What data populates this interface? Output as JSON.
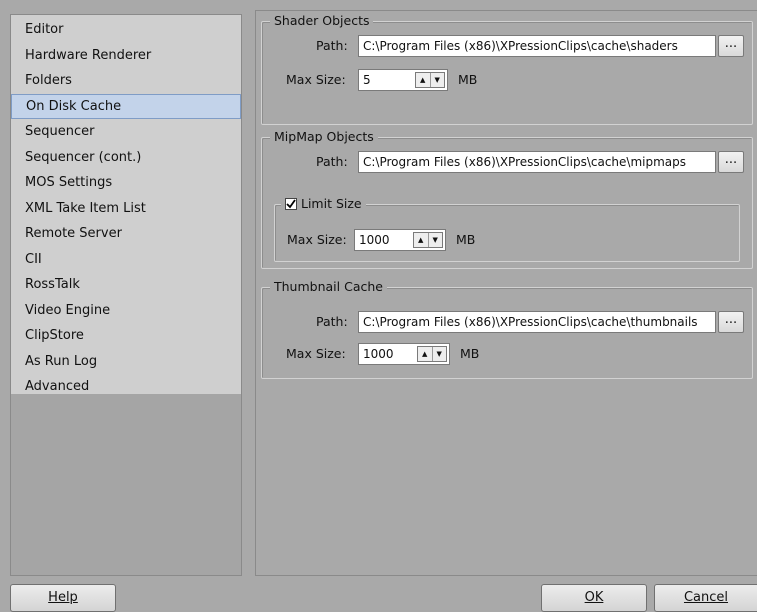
{
  "sidebar": {
    "items": [
      {
        "label": "Editor"
      },
      {
        "label": "Hardware Renderer"
      },
      {
        "label": "Folders"
      },
      {
        "label": "On Disk Cache",
        "selected": true
      },
      {
        "label": "Sequencer"
      },
      {
        "label": "Sequencer (cont.)"
      },
      {
        "label": "MOS Settings"
      },
      {
        "label": "XML Take Item List"
      },
      {
        "label": "Remote Server"
      },
      {
        "label": "CII"
      },
      {
        "label": "RossTalk"
      },
      {
        "label": "Video Engine"
      },
      {
        "label": "ClipStore"
      },
      {
        "label": "As Run Log"
      },
      {
        "label": "Advanced"
      }
    ]
  },
  "shader": {
    "title": "Shader Objects",
    "path_label": "Path:",
    "path_value": "C:\\Program Files (x86)\\XPressionClips\\cache\\shaders",
    "browse_label": "...",
    "maxsize_label": "Max Size:",
    "maxsize_value": "5",
    "unit": "MB"
  },
  "mipmap": {
    "title": "MipMap Objects",
    "path_label": "Path:",
    "path_value": "C:\\Program Files (x86)\\XPressionClips\\cache\\mipmaps",
    "browse_label": "...",
    "limit_label": "Limit Size",
    "limit_checked": true,
    "maxsize_label": "Max Size:",
    "maxsize_value": "1000",
    "unit": "MB"
  },
  "thumbnail": {
    "title": "Thumbnail Cache",
    "path_label": "Path:",
    "path_value": "C:\\Program Files (x86)\\XPressionClips\\cache\\thumbnails",
    "browse_label": "...",
    "maxsize_label": "Max Size:",
    "maxsize_value": "1000",
    "unit": "MB"
  },
  "footer": {
    "help_label": "Help",
    "ok_label": "OK",
    "cancel_label": "Cancel"
  },
  "colors": {
    "background": "#a9a9a9",
    "list_background": "#cfcfcf",
    "selection": "#c3d3ea"
  }
}
